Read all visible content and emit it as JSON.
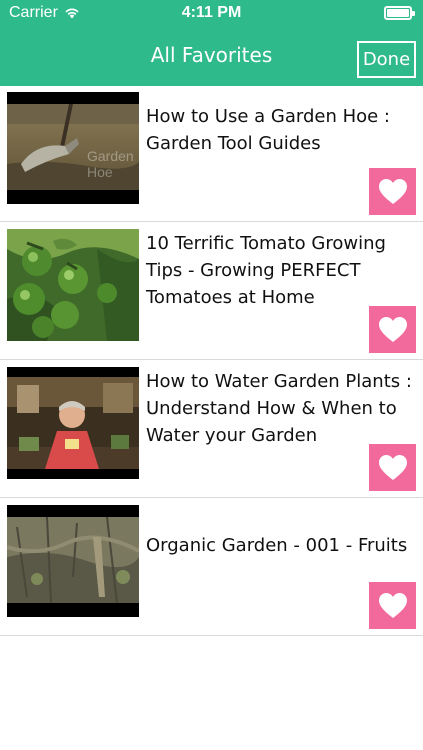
{
  "status_bar": {
    "carrier": "Carrier",
    "time": "4:11 PM",
    "battery_level": 1.0
  },
  "nav": {
    "title": "All Favorites",
    "done_label": "Done"
  },
  "favorites": [
    {
      "title": "How to Use a Garden Hoe : Garden Tool Guides",
      "thumb_icon": "garden-hoe-thumbnail",
      "thumb_caption": "Garden Hoe"
    },
    {
      "title": "10 Terrific Tomato Growing Tips - Growing PERFECT Tomatoes at Home",
      "thumb_icon": "tomato-plant-thumbnail"
    },
    {
      "title": "How to Water Garden Plants : Understand How & When to Water your Garden",
      "thumb_icon": "man-in-greenhouse-thumbnail"
    },
    {
      "title": "Organic Garden - 001 - Fruits",
      "thumb_icon": "garden-ground-thumbnail"
    }
  ],
  "colors": {
    "accent": "#2fba8c",
    "heart_button": "#f26a9c",
    "divider": "#d9d9d9"
  },
  "icons": {
    "favorite": "heart-icon",
    "wifi": "wifi-icon",
    "battery": "battery-icon"
  }
}
